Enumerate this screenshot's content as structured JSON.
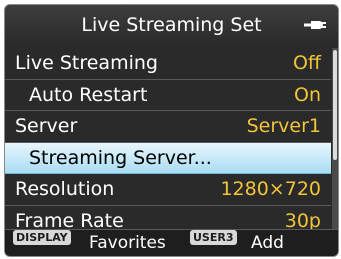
{
  "header": {
    "title": "Live Streaming Set",
    "icon": "battery-plug-icon"
  },
  "menu": [
    {
      "label": "Live Streaming",
      "value": "Off",
      "sub": false,
      "selected": false
    },
    {
      "label": "Auto Restart",
      "value": "On",
      "sub": true,
      "selected": false
    },
    {
      "label": "Server",
      "value": "Server1",
      "sub": false,
      "selected": false
    },
    {
      "label": "Streaming Server...",
      "value": "",
      "sub": true,
      "selected": true
    },
    {
      "label": "Resolution",
      "value": "1280×720",
      "sub": false,
      "selected": false
    },
    {
      "label": "Frame Rate",
      "value": "30p",
      "sub": false,
      "selected": false
    }
  ],
  "footer": {
    "key1": "DISPLAY",
    "text1": "Favorites",
    "key2": "USER3",
    "text2": "Add"
  },
  "colors": {
    "value_text": "#f2c438",
    "selected_bg": "#a9dcf3",
    "background": "#2a2a2a"
  }
}
